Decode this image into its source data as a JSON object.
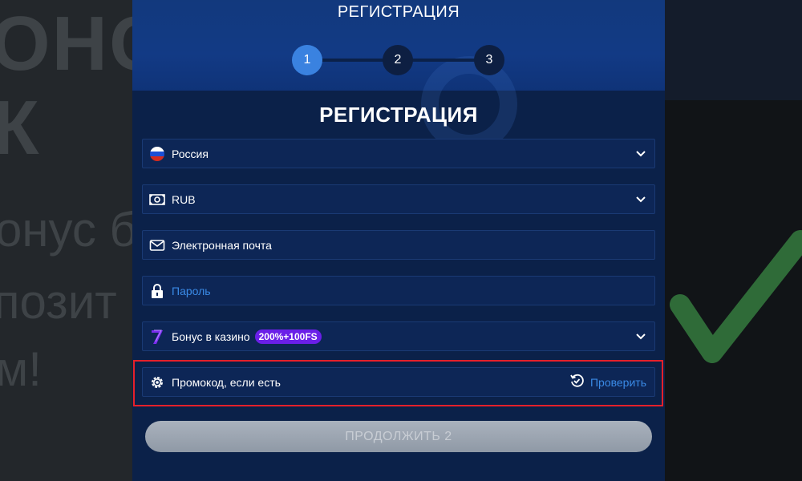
{
  "background": {
    "line1": "ОНСКИИ",
    "line2": "К",
    "line3": "онус б",
    "line4": "позит",
    "line5": "м!"
  },
  "header": {
    "title": "РЕГИСТРАЦИЯ",
    "steps": [
      "1",
      "2",
      "3"
    ],
    "active_step": 1
  },
  "form": {
    "title": "РЕГИСТРАЦИЯ",
    "country": {
      "value": "Россия",
      "icon": "russia-flag-icon"
    },
    "currency": {
      "value": "RUB",
      "icon": "banknote-icon"
    },
    "email": {
      "placeholder": "Электронная почта",
      "icon": "envelope-icon"
    },
    "password": {
      "placeholder": "Пароль",
      "icon": "lock-icon"
    },
    "bonus": {
      "label": "Бонус в казино",
      "badge": "200%+100FS",
      "icon": "seven-logo-icon"
    },
    "promo": {
      "placeholder": "Промокод, если есть",
      "check_label": "Проверить",
      "icon": "gear-icon"
    },
    "continue_label": "ПРОДОЛЖИТЬ 2"
  },
  "colors": {
    "modal_bg": "#0b2149",
    "accent": "#3a82e0",
    "highlight": "#e5202a",
    "badge": "#6a1fe8"
  }
}
